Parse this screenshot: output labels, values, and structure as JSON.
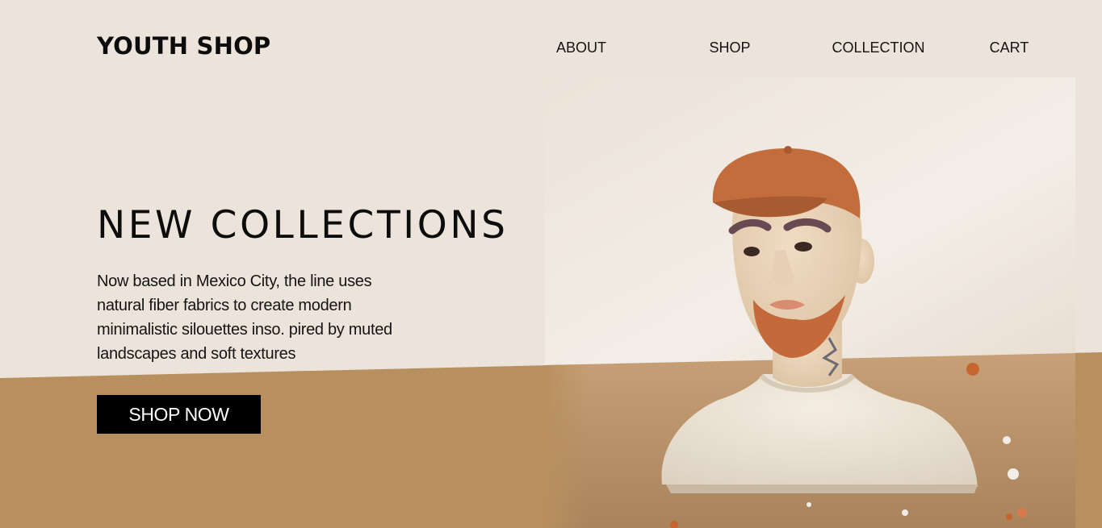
{
  "brand": {
    "name": "YOUTH SHOP"
  },
  "nav": {
    "items": [
      {
        "label": "ABOUT"
      },
      {
        "label": "SHOP"
      },
      {
        "label": "COLLECTION"
      },
      {
        "label": "CART"
      }
    ]
  },
  "hero": {
    "title": "NEW COLLECTIONS",
    "description": "Now based in Mexico City, the line uses natural fiber fabrics to create modern minimalistic silouettes inso. pired by muted landscapes and soft textures",
    "cta_label": "SHOP NOW",
    "image_subject": "clay-bust-figure"
  },
  "colors": {
    "background": "#ece4da",
    "band": "#b8905f",
    "button_bg": "#000000",
    "button_text": "#ffffff"
  }
}
